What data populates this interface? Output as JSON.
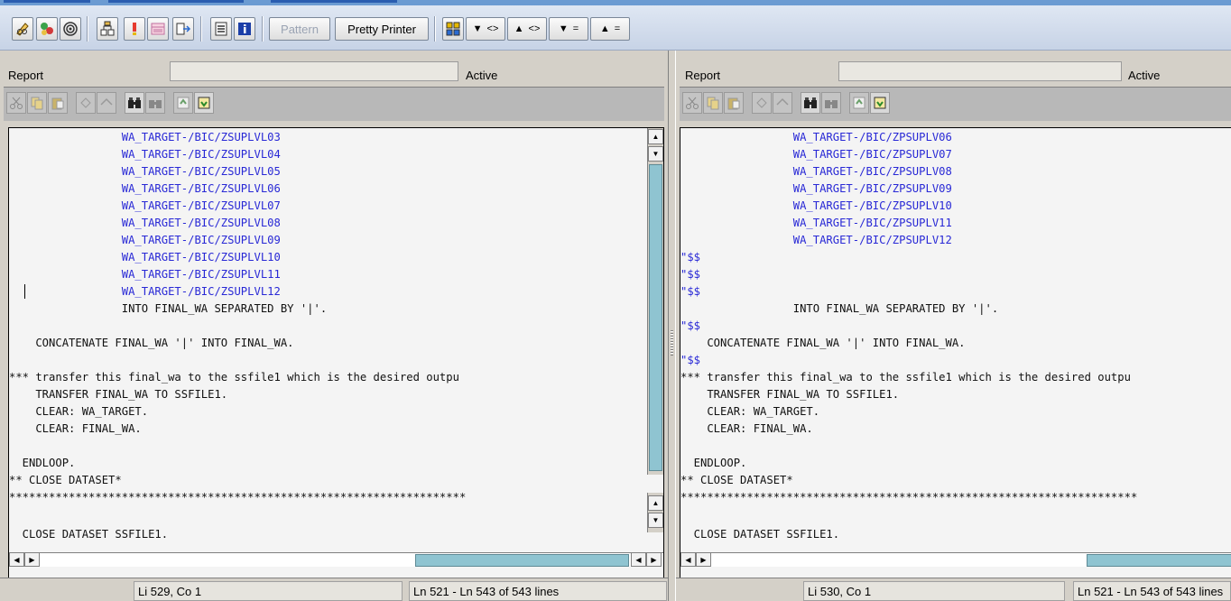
{
  "toolbar": {
    "pattern_label": "Pattern",
    "pretty_printer_label": "Pretty Printer",
    "sort_buttons": [
      {
        "arrow": "▼",
        "symbol": "<>"
      },
      {
        "arrow": "▲",
        "symbol": "<>"
      },
      {
        "arrow": "▼",
        "symbol": "="
      },
      {
        "arrow": "▲",
        "symbol": "="
      }
    ]
  },
  "left": {
    "header_label": "Report",
    "status_label": "Active",
    "code_lines": [
      {
        "text": "                 WA_TARGET-/BIC/ZSUPLVL03",
        "kind": "blue"
      },
      {
        "text": "                 WA_TARGET-/BIC/ZSUPLVL04",
        "kind": "blue"
      },
      {
        "text": "                 WA_TARGET-/BIC/ZSUPLVL05",
        "kind": "blue"
      },
      {
        "text": "                 WA_TARGET-/BIC/ZSUPLVL06",
        "kind": "blue"
      },
      {
        "text": "                 WA_TARGET-/BIC/ZSUPLVL07",
        "kind": "blue"
      },
      {
        "text": "                 WA_TARGET-/BIC/ZSUPLVL08",
        "kind": "blue"
      },
      {
        "text": "                 WA_TARGET-/BIC/ZSUPLVL09",
        "kind": "blue"
      },
      {
        "text": "                 WA_TARGET-/BIC/ZSUPLVL10",
        "kind": "blue"
      },
      {
        "text": "                 WA_TARGET-/BIC/ZSUPLVL11",
        "kind": "blue"
      },
      {
        "text": "                 WA_TARGET-/BIC/ZSUPLVL12",
        "kind": "blue"
      },
      {
        "text": "                 INTO FINAL_WA SEPARATED BY '|'.",
        "kind": "plain"
      },
      {
        "text": "",
        "kind": "plain"
      },
      {
        "text": "    CONCATENATE FINAL_WA '|' INTO FINAL_WA.",
        "kind": "plain"
      },
      {
        "text": "",
        "kind": "plain"
      },
      {
        "text": "*** transfer this final_wa to the ssfile1 which is the desired outpu",
        "kind": "plain"
      },
      {
        "text": "    TRANSFER FINAL_WA TO SSFILE1.",
        "kind": "plain"
      },
      {
        "text": "    CLEAR: WA_TARGET.",
        "kind": "plain"
      },
      {
        "text": "    CLEAR: FINAL_WA.",
        "kind": "plain"
      },
      {
        "text": "",
        "kind": "plain"
      },
      {
        "text": "  ENDLOOP.",
        "kind": "plain"
      },
      {
        "text": "** CLOSE DATASET*",
        "kind": "plain"
      },
      {
        "text": "*********************************************************************",
        "kind": "plain"
      },
      {
        "text": "  CLOSE DATASET SSFILE1.",
        "kind": "plain"
      }
    ],
    "status_position": "Li 529, Co 1",
    "status_range": "Ln 521 - Ln 543 of 543 lines"
  },
  "right": {
    "header_label": "Report",
    "status_label": "Active",
    "code_lines": [
      {
        "text": "                 WA_TARGET-/BIC/ZPSUPLV06",
        "kind": "blue"
      },
      {
        "text": "                 WA_TARGET-/BIC/ZPSUPLV07",
        "kind": "blue"
      },
      {
        "text": "                 WA_TARGET-/BIC/ZPSUPLV08",
        "kind": "blue"
      },
      {
        "text": "                 WA_TARGET-/BIC/ZPSUPLV09",
        "kind": "blue"
      },
      {
        "text": "                 WA_TARGET-/BIC/ZPSUPLV10",
        "kind": "blue"
      },
      {
        "text": "                 WA_TARGET-/BIC/ZPSUPLV11",
        "kind": "blue"
      },
      {
        "text": "                 WA_TARGET-/BIC/ZPSUPLV12",
        "kind": "blue"
      },
      {
        "text": "\"$$",
        "kind": "blue"
      },
      {
        "text": "\"$$",
        "kind": "blue"
      },
      {
        "text": "\"$$",
        "kind": "blue"
      },
      {
        "text": "                 INTO FINAL_WA SEPARATED BY '|'.",
        "kind": "plain"
      },
      {
        "text": "\"$$",
        "kind": "blue"
      },
      {
        "text": "    CONCATENATE FINAL_WA '|' INTO FINAL_WA.",
        "kind": "plain"
      },
      {
        "text": "\"$$",
        "kind": "blue"
      },
      {
        "text": "*** transfer this final_wa to the ssfile1 which is the desired outpu",
        "kind": "plain"
      },
      {
        "text": "    TRANSFER FINAL_WA TO SSFILE1.",
        "kind": "plain"
      },
      {
        "text": "    CLEAR: WA_TARGET.",
        "kind": "plain"
      },
      {
        "text": "    CLEAR: FINAL_WA.",
        "kind": "plain"
      },
      {
        "text": "",
        "kind": "plain"
      },
      {
        "text": "  ENDLOOP.",
        "kind": "plain"
      },
      {
        "text": "** CLOSE DATASET*",
        "kind": "plain"
      },
      {
        "text": "*********************************************************************",
        "kind": "plain"
      },
      {
        "text": "  CLOSE DATASET SSFILE1.",
        "kind": "plain"
      }
    ],
    "status_position": "Li 530, Co 1",
    "status_range": "Ln 521 - Ln 543 of 543 lines"
  },
  "colors": {
    "keyword_blue": "#2929d6",
    "scroll_thumb": "#8fc4d1",
    "toolbar_bg": "#c7d3e6"
  },
  "icons": [
    "pencil-glasses-icon",
    "where-used-icon",
    "spiral-icon",
    "hierarchy-icon",
    "exclamation-icon",
    "window-icon",
    "navigate-icon",
    "list-icon",
    "info-icon",
    "scissors-icon",
    "copy-icon",
    "paste-icon",
    "undo-icon",
    "redo-icon",
    "binoculars-icon",
    "binoculars-next-icon",
    "upload-icon",
    "download-icon"
  ]
}
